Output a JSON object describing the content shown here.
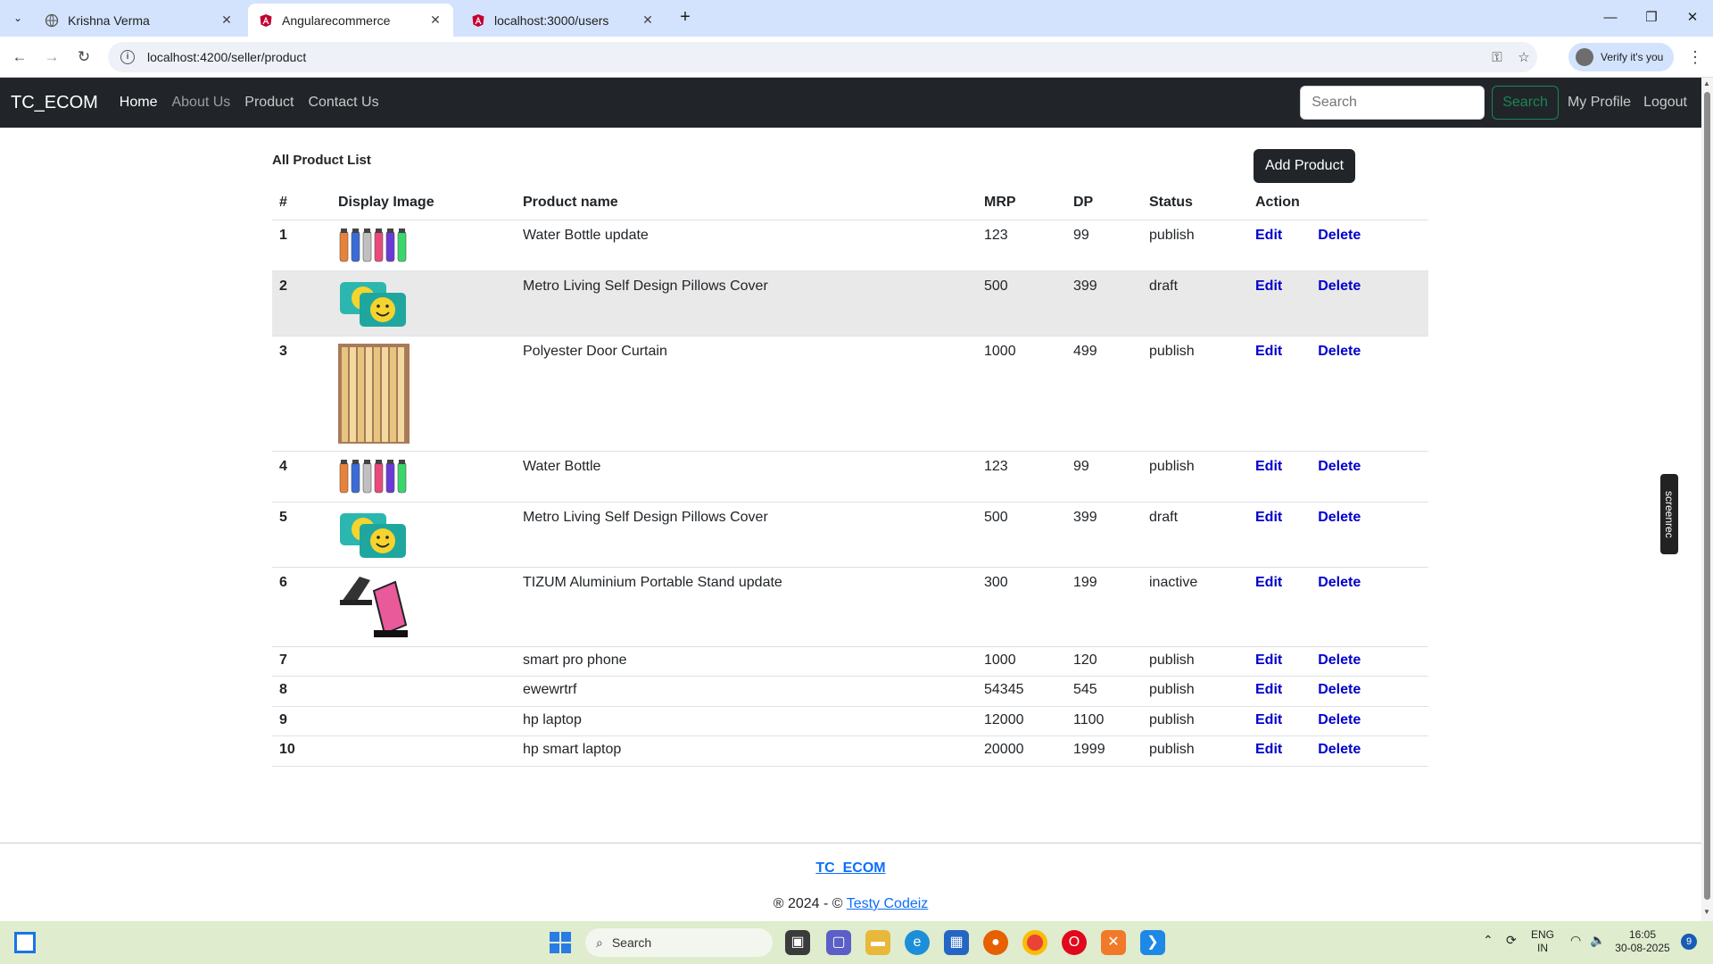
{
  "browser": {
    "tabs": [
      {
        "title": "Krishna Verma",
        "active": false
      },
      {
        "title": "Angularecommerce",
        "active": true
      },
      {
        "title": "localhost:3000/users",
        "active": false
      }
    ],
    "url": "localhost:4200/seller/product",
    "verify_label": "Verify it's you"
  },
  "nav": {
    "brand": "TC_ECOM",
    "links": [
      "Home",
      "About Us",
      "Product",
      "Contact Us"
    ],
    "search_placeholder": "Search",
    "search_button": "Search",
    "profile": "My Profile",
    "logout": "Logout"
  },
  "page": {
    "title": "All Product List",
    "add_button": "Add Product"
  },
  "table": {
    "headers": [
      "#",
      "Display Image",
      "Product name",
      "MRP",
      "DP",
      "Status",
      "Action"
    ],
    "edit_label": "Edit",
    "delete_label": "Delete",
    "rows": [
      {
        "n": "1",
        "image": "bottles",
        "name": "Water Bottle update",
        "mrp": "123",
        "dp": "99",
        "status": "publish"
      },
      {
        "n": "2",
        "image": "pillows",
        "name": "Metro Living Self Design Pillows Cover",
        "mrp": "500",
        "dp": "399",
        "status": "draft"
      },
      {
        "n": "3",
        "image": "curtain",
        "name": "Polyester Door Curtain",
        "mrp": "1000",
        "dp": "499",
        "status": "publish"
      },
      {
        "n": "4",
        "image": "bottles",
        "name": "Water Bottle",
        "mrp": "123",
        "dp": "99",
        "status": "publish"
      },
      {
        "n": "5",
        "image": "pillows",
        "name": "Metro Living Self Design Pillows Cover",
        "mrp": "500",
        "dp": "399",
        "status": "draft"
      },
      {
        "n": "6",
        "image": "stand",
        "name": "TIZUM Aluminium Portable Stand update",
        "mrp": "300",
        "dp": "199",
        "status": "inactive"
      },
      {
        "n": "7",
        "image": "",
        "name": "smart pro phone",
        "mrp": "1000",
        "dp": "120",
        "status": "publish"
      },
      {
        "n": "8",
        "image": "",
        "name": "ewewrtrf",
        "mrp": "54345",
        "dp": "545",
        "status": "publish"
      },
      {
        "n": "9",
        "image": "",
        "name": "hp laptop",
        "mrp": "12000",
        "dp": "1100",
        "status": "publish"
      },
      {
        "n": "10",
        "image": "",
        "name": "hp smart laptop",
        "mrp": "20000",
        "dp": "1999",
        "status": "publish"
      }
    ]
  },
  "footer": {
    "brand": "TC_ECOM",
    "copy_prefix": "® 2024 - ©",
    "copy_link": "Testy Codeiz"
  },
  "overlay": {
    "screenrec": "screenrec"
  },
  "taskbar": {
    "search_placeholder": "Search",
    "lang": "ENG",
    "region": "IN",
    "time": "16:05",
    "date": "30-08-2025",
    "notifications": "9"
  }
}
